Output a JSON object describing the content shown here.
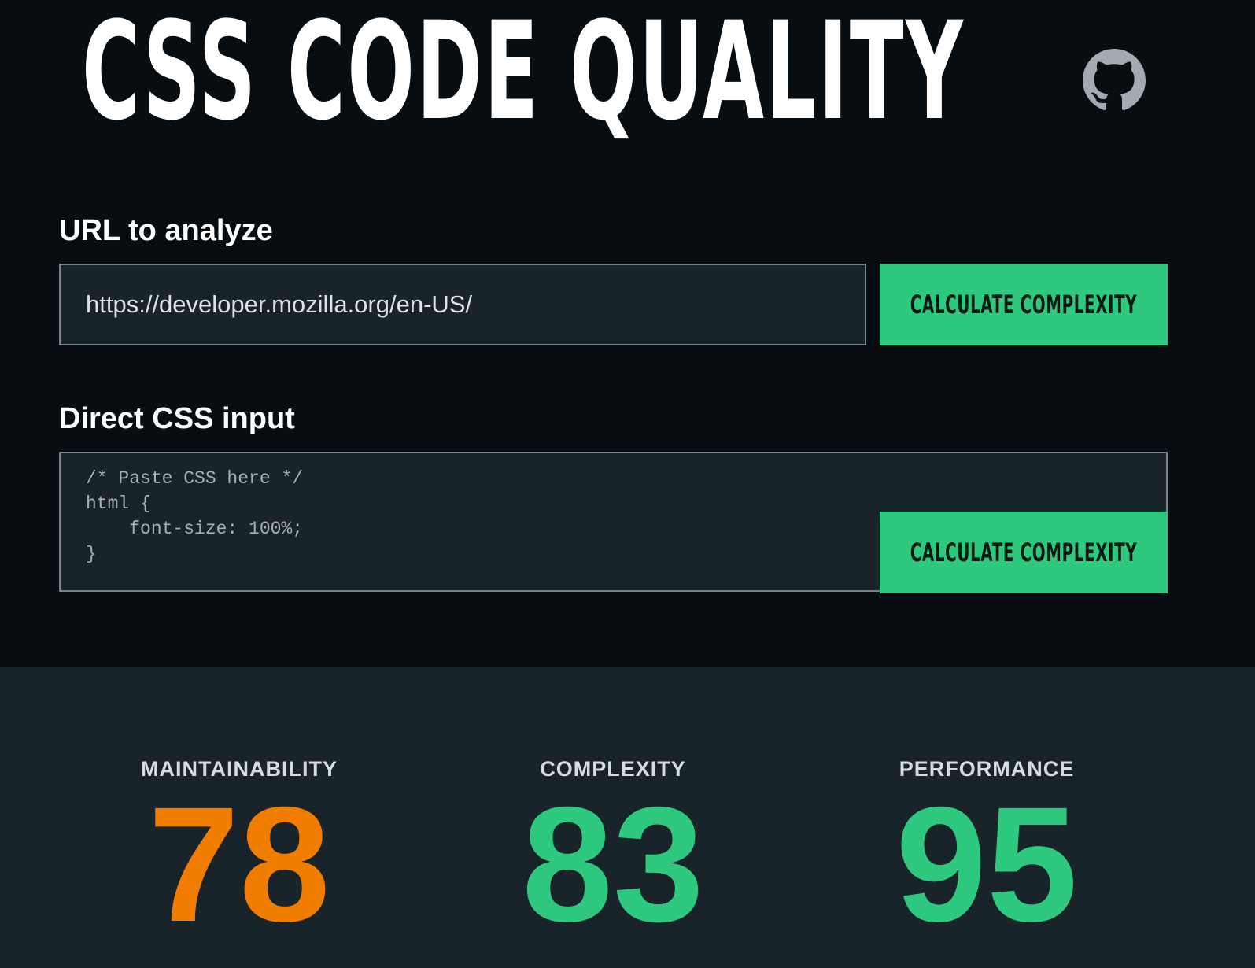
{
  "header": {
    "title": "CSS CODE QUALITY",
    "github_icon": "github-icon"
  },
  "url_section": {
    "label": "URL to analyze",
    "input_value": "https://developer.mozilla.org/en-US/",
    "button_label": "CALCULATE COMPLEXITY"
  },
  "css_section": {
    "label": "Direct CSS input",
    "textarea_value": "/* Paste CSS here */\nhtml {\n    font-size: 100%;\n}",
    "button_label": "CALCULATE COMPLEXITY"
  },
  "scores": [
    {
      "label": "MAINTAINABILITY",
      "value": "78",
      "color": "#f07d00"
    },
    {
      "label": "COMPLEXITY",
      "value": "83",
      "color": "#2ec97e"
    },
    {
      "label": "PERFORMANCE",
      "value": "95",
      "color": "#2ec97e"
    }
  ],
  "colors": {
    "background": "#070d10",
    "panel": "#19232a",
    "accent_green": "#2ec97e",
    "accent_orange": "#f07d00"
  }
}
